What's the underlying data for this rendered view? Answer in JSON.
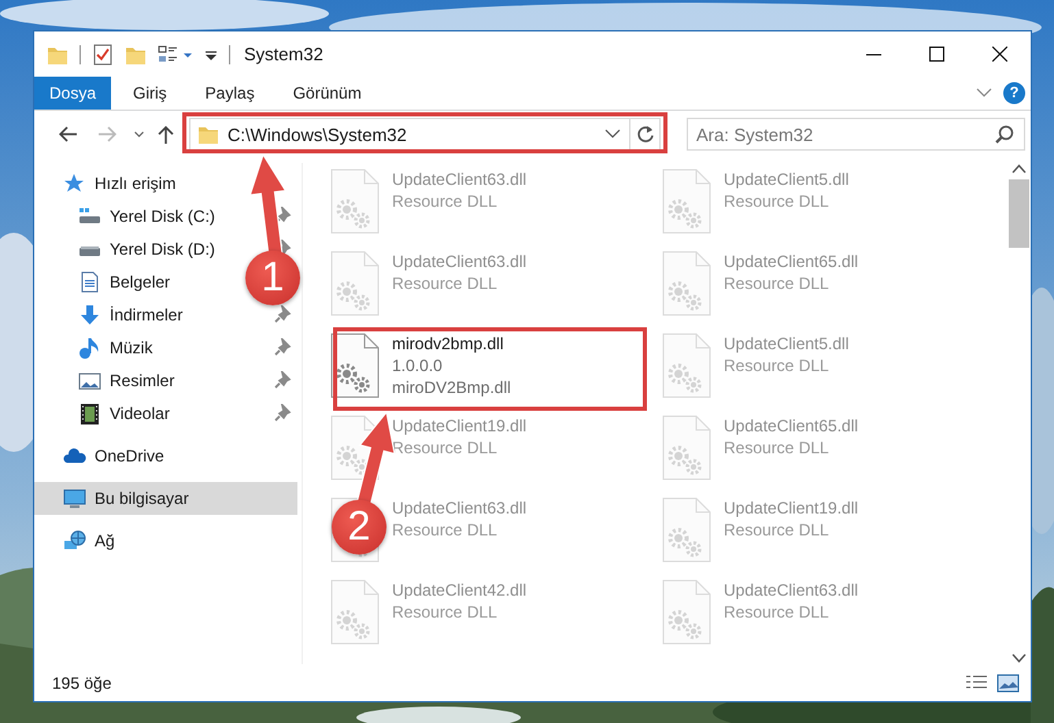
{
  "window": {
    "title": "System32"
  },
  "ribbon": {
    "tabs": [
      {
        "label": "Dosya",
        "kind": "file"
      },
      {
        "label": "Giriş",
        "kind": "tab"
      },
      {
        "label": "Paylaş",
        "kind": "tab"
      },
      {
        "label": "Görünüm",
        "kind": "tab"
      }
    ],
    "help": "?"
  },
  "address_bar": {
    "path": "C:\\Windows\\System32"
  },
  "search": {
    "placeholder": "Ara: System32"
  },
  "navigation": [
    {
      "label": "Hızlı erişim",
      "selected": false,
      "children": [
        {
          "label": "Yerel Disk (C:)",
          "pinned": true,
          "selected": false
        },
        {
          "label": "Yerel Disk (D:)",
          "pinned": true,
          "selected": false
        },
        {
          "label": "Belgeler",
          "selected": false
        },
        {
          "label": "İndirmeler",
          "pinned": true,
          "selected": false
        },
        {
          "label": "Müzik",
          "pinned": true,
          "selected": false
        },
        {
          "label": "Resimler",
          "pinned": true,
          "selected": false
        },
        {
          "label": "Videolar",
          "pinned": true,
          "selected": false
        }
      ]
    },
    {
      "label": "OneDrive",
      "selected": false
    },
    {
      "label": "Bu bilgisayar",
      "selected": true
    },
    {
      "label": "Ağ",
      "selected": false
    }
  ],
  "files": [
    {
      "name": "UpdateClient63.dll",
      "details": [
        "Resource DLL"
      ],
      "faded": true
    },
    {
      "name": "UpdateClient5.dll",
      "details": [
        "Resource DLL"
      ],
      "faded": true
    },
    {
      "name": "UpdateClient63.dll",
      "details": [
        "Resource DLL"
      ],
      "faded": true
    },
    {
      "name": "UpdateClient65.dll",
      "details": [
        "Resource DLL"
      ],
      "faded": true
    },
    {
      "name": "mirodv2bmp.dll",
      "details": [
        "1.0.0.0",
        "miroDV2Bmp.dll"
      ],
      "faded": false
    },
    {
      "name": "UpdateClient5.dll",
      "details": [
        "Resource DLL"
      ],
      "faded": true
    },
    {
      "name": "UpdateClient19.dll",
      "details": [
        "Resource DLL"
      ],
      "faded": true
    },
    {
      "name": "UpdateClient65.dll",
      "details": [
        "Resource DLL"
      ],
      "faded": true
    },
    {
      "name": "UpdateClient63.dll",
      "details": [
        "Resource DLL"
      ],
      "faded": true
    },
    {
      "name": "UpdateClient19.dll",
      "details": [
        "Resource DLL"
      ],
      "faded": true
    },
    {
      "name": "UpdateClient42.dll",
      "details": [
        "Resource DLL"
      ],
      "faded": true
    },
    {
      "name": "UpdateClient63.dll",
      "details": [
        "Resource DLL"
      ],
      "faded": true
    }
  ],
  "status_bar": {
    "item_count": "195 öğe"
  },
  "annotations": [
    {
      "number": "1"
    },
    {
      "number": "2"
    }
  ]
}
